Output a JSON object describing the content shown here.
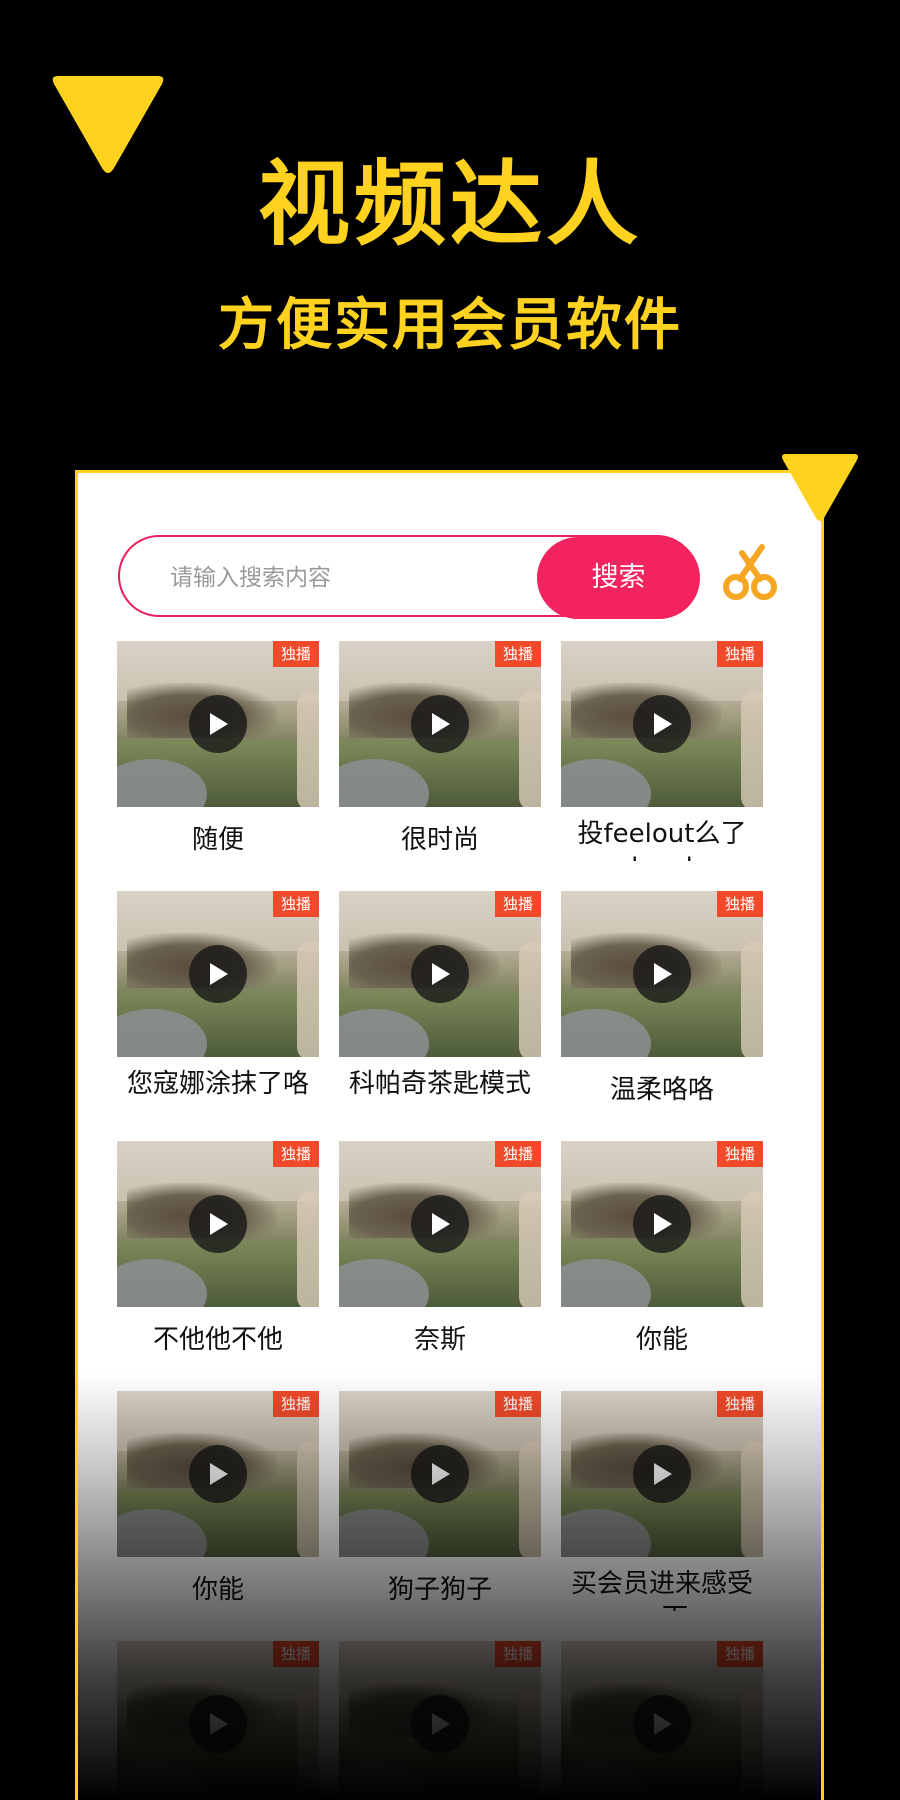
{
  "promo": {
    "title": "视频达人",
    "subtitle": "方便实用会员软件"
  },
  "colors": {
    "accent_yellow": "#ffd21f",
    "search_red": "#f2235e",
    "badge_red": "#f04a2a",
    "scissors_orange": "#f5a623"
  },
  "search": {
    "placeholder": "请输入搜索内容",
    "button_label": "搜索",
    "icon": "scissors-icon"
  },
  "videos": [
    {
      "title": "随便",
      "badge": "独播"
    },
    {
      "title": "很时尚",
      "badge": "独播"
    },
    {
      "title": "投feelout么了level",
      "badge": "独播"
    },
    {
      "title": "您寇娜涂抹了咯",
      "badge": "独播"
    },
    {
      "title": "科帕奇茶匙模式",
      "badge": "独播"
    },
    {
      "title": "温柔咯咯",
      "badge": "独播"
    },
    {
      "title": "不他他不他",
      "badge": "独播"
    },
    {
      "title": "奈斯",
      "badge": "独播"
    },
    {
      "title": "你能",
      "badge": "独播"
    },
    {
      "title": "你能",
      "badge": "独播"
    },
    {
      "title": "狗子狗子",
      "badge": "独播"
    },
    {
      "title": "买会员进来感受一下",
      "badge": "独播"
    },
    {
      "title": "",
      "badge": "独播"
    },
    {
      "title": "",
      "badge": "独播"
    },
    {
      "title": "",
      "badge": "独播"
    }
  ]
}
